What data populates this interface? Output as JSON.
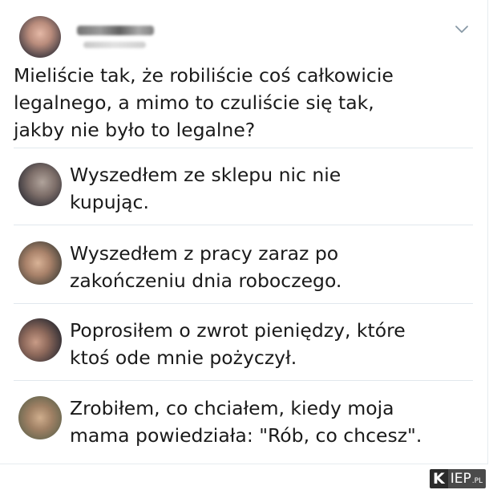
{
  "tweet": {
    "text": "Mieliście tak, że robiliście coś całkowicie\nlegalnego, a mimo to czuliście się tak,\njakby nie było to legalne?"
  },
  "replies": [
    {
      "text": "Wyszedłem ze sklepu nic nie\nkupując."
    },
    {
      "text": "Wyszedłem z pracy zaraz po\nzakończeniu dnia roboczego."
    },
    {
      "text": "Poprosiłem o zwrot pieniędzy, które\nktoś ode mnie pożyczył."
    },
    {
      "text": "Zrobiłem, co chciałem, kiedy moja\nmama powiedziała: \"Rób, co chcesz\"."
    }
  ],
  "icons": {
    "menu": "chevron-down-icon"
  },
  "watermark": {
    "k": "K",
    "rest": "IEP",
    "suffix": ".PL"
  },
  "colors": {
    "divider": "#e1e8ed",
    "text": "#1a1a1a",
    "chevron": "#8899a6"
  }
}
